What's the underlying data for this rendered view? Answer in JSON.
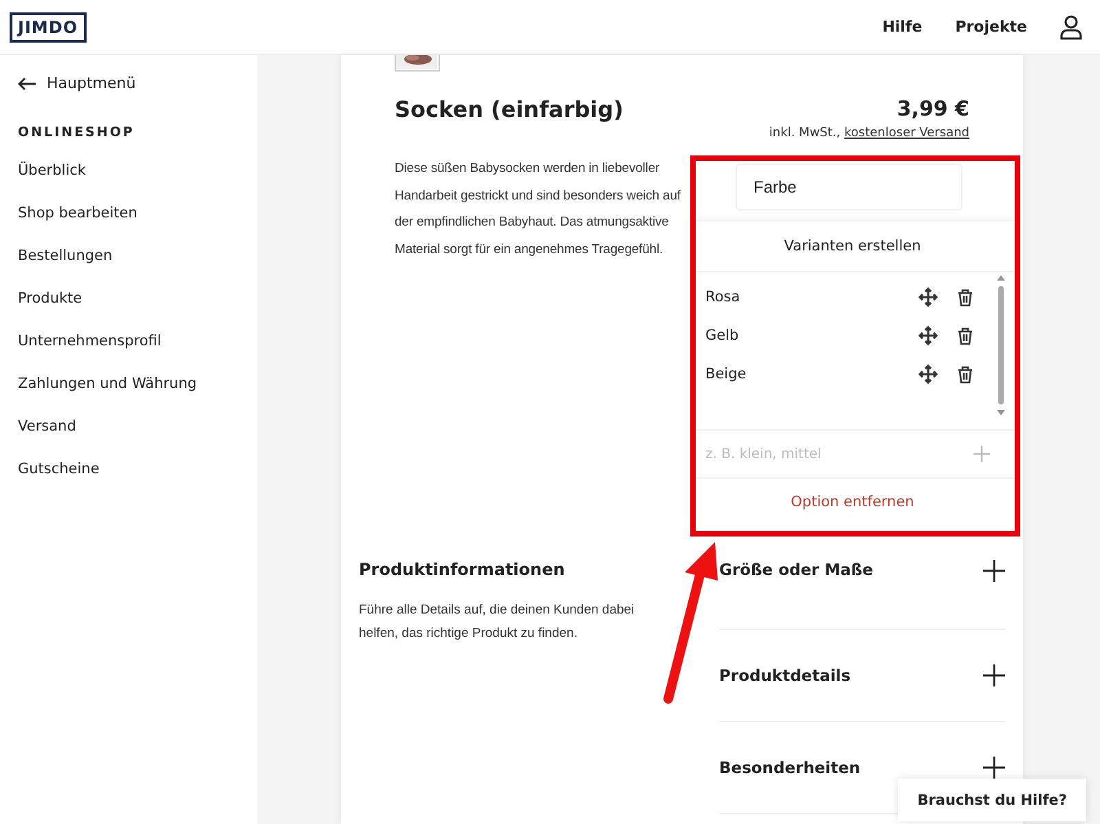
{
  "header": {
    "logo": "JIMDO",
    "links": [
      "Hilfe",
      "Projekte"
    ]
  },
  "sidebar": {
    "back": "Hauptmenü",
    "section": "ONLINESHOP",
    "items": [
      "Überblick",
      "Shop bearbeiten",
      "Bestellungen",
      "Produkte",
      "Unternehmensprofil",
      "Zahlungen und Währung",
      "Versand",
      "Gutscheine"
    ]
  },
  "product": {
    "title": "Socken (einfarbig)",
    "price": "3,99 €",
    "tax_note": "inkl. MwSt.,",
    "shipping_link": "kostenloser Versand",
    "description": "Diese süßen Babysocken werden in liebevoller Handarbeit gestrickt und sind besonders weich auf der empfindlichen Babyhaut. Das atmungsaktive Material sorgt für ein angenehmes Tragegefühl.",
    "option_name": "Farbe",
    "variants_title": "Varianten erstellen",
    "variants": [
      "Rosa",
      "Gelb",
      "Beige"
    ],
    "new_variant_placeholder": "z. B. klein, mittel",
    "remove_option": "Option entfernen"
  },
  "info": {
    "title": "Produktinformationen",
    "text": "Führe alle Details auf, die deinen Kunden dabei helfen, das richtige Produkt zu finden."
  },
  "sections": [
    "Größe oder Maße",
    "Produktdetails",
    "Besonderheiten"
  ],
  "help_button": "Brauchst du Hilfe?"
}
